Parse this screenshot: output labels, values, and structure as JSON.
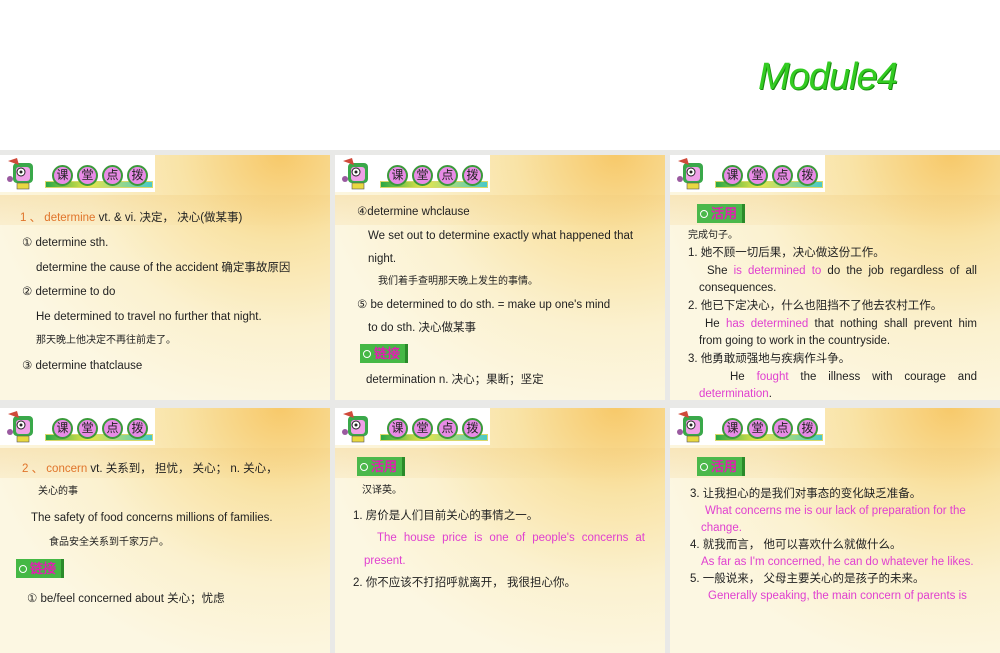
{
  "title": "Module4",
  "header_chars": [
    "课",
    "堂",
    "点",
    "拨"
  ],
  "badges": {
    "apply": "活用",
    "link": "链接"
  },
  "s1": {
    "num": "1 、",
    "word": "determine",
    "def": " vt. & vi.  决定，  决心(做某事)",
    "l1": "① determine sth.",
    "l2": "determine the cause of the accident  确定事故原因",
    "l3": "② determine to do",
    "l4": "He determined to travel no further that night.",
    "l5": "那天晚上他决定不再往前走了。",
    "l6": "③ determine thatclause"
  },
  "s2": {
    "l1": "④determine whclause",
    "l2": "We set out to determine exactly what happened that",
    "l3": "night.",
    "l4": "我们着手查明那天晚上发生的事情。",
    "l5": "⑤ be determined to do sth.  =   make up one's mind",
    "l6": "to do sth. 决心做某事",
    "l7": "determination n.  决心；果断；坚定"
  },
  "s3": {
    "intro": "完成句子。",
    "q1": "1. 她不顾一切后果，决心做这份工作。",
    "a1a": "She ",
    "a1b": "is determined to",
    "a1c": " do the job regardless of all",
    "a1d": "consequences.",
    "q2": "2. 他已下定决心，什么也阻挡不了他去农村工作。",
    "a2a": "He ",
    "a2b": "has determined",
    "a2c": " that nothing shall prevent him",
    "a2d": "from going to work in the countryside.",
    "q3": "3. 他勇敢顽强地与疾病作斗争。",
    "a3a": "He ",
    "a3b": "fought",
    "a3c": " the illness with courage and",
    "a3d": "determination",
    "a3e": "."
  },
  "s4": {
    "num": "2 、",
    "word": "concern",
    "def": " vt.  关系到，  担忧，  关心；  n.  关心，",
    "l1": "关心的事",
    "l2": "The safety of food concerns millions of families.",
    "l3": "食品安全关系到千家万户。",
    "l4": "① be/feel concerned about  关心；忧虑"
  },
  "s5": {
    "intro": "汉译英。",
    "q1": "1. 房价是人们目前关心的事情之一。",
    "a1": "The house price is one of people's concerns at",
    "a1b": "present.",
    "q2": "2. 你不应该不打招呼就离开，  我很担心你。"
  },
  "s6": {
    "q3": "3. 让我担心的是我们对事态的变化缺乏准备。",
    "a3": "What concerns me is our lack of preparation for the",
    "a3b": "change.",
    "q4": "4. 就我而言，  他可以喜欢什么就做什么。",
    "a4": "As far as I'm concerned, he can do whatever he likes.",
    "q5": "5. 一般说来，  父母主要关心的是孩子的未来。",
    "a5": "Generally speaking, the main concern of parents is"
  }
}
